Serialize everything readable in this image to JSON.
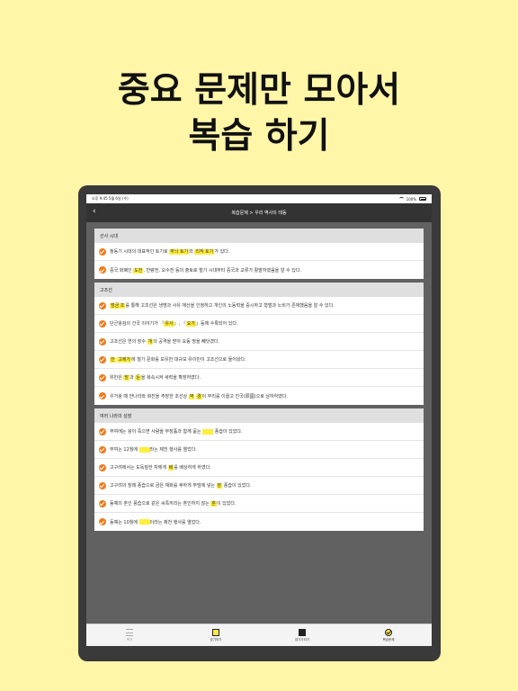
{
  "headline": {
    "line1": "중요 문제만 모아서",
    "line2": "복습 하기"
  },
  "status": {
    "time": "오후 9:45",
    "date": "5월 6일 (수)",
    "battery": "100%"
  },
  "nav": {
    "title": "복습문제 > 우리 역사의 태동"
  },
  "sections": [
    {
      "title": "선사 시대",
      "items": [
        {
          "parts": [
            {
              "t": "청동기 시대의 대표적인 토기로 "
            },
            {
              "t": "무늬 토기",
              "hl": true
            },
            {
              "t": "와 "
            },
            {
              "t": "리작 토기",
              "hl": true
            },
            {
              "t": "가 있다."
            }
          ]
        },
        {
          "parts": [
            {
              "t": "중국 화폐인 "
            },
            {
              "t": "도전",
              "hl": true
            },
            {
              "t": ", 반량전, 오수전 등의 출토로 철기 시대부터 중국과 교류가 활발하였음을 알 수 있다."
            }
          ]
        }
      ]
    },
    {
      "title": "고조선",
      "items": [
        {
          "parts": [
            {
              "t": "범금 조",
              "hl": true
            },
            {
              "t": "를 통해 고조선은 생명과 사유 재산을 인정하고 개인의 노동력을 중시하고 형벌과 노비가 존재했음을 알 수 있다."
            }
          ]
        },
        {
          "parts": [
            {
              "t": "단군왕검의 건국 이야기가 『"
            },
            {
              "t": "유사",
              "hl": true
            },
            {
              "t": "』, 『"
            },
            {
              "t": "요가",
              "hl": true
            },
            {
              "t": "』등에 수록되어 있다."
            }
          ]
        },
        {
          "parts": [
            {
              "t": "고조선은 연의 장수 "
            },
            {
              "t": "개",
              "hl": true
            },
            {
              "t": "의 공격을 받아 요동 땅을 빼앗겼다."
            }
          ]
        },
        {
          "parts": [
            {
              "t": "한",
              "hl": true
            },
            {
              "t": " "
            },
            {
              "t": "고제가",
              "hl": true
            },
            {
              "t": "에 철기 문화를 보유한 대규모 유이민이 고조선으로 들어왔다."
            }
          ]
        },
        {
          "parts": [
            {
              "t": "위만은 "
            },
            {
              "t": "방",
              "hl": true
            },
            {
              "t": "과 "
            },
            {
              "t": "둔",
              "hl": true
            },
            {
              "t": "을 복속시켜 세력을 확장하였다."
            }
          ]
        },
        {
          "parts": [
            {
              "t": "우거왕 때 한나라와 화친을 주장한 조선상 "
            },
            {
              "t": "역",
              "hl": true
            },
            {
              "t": " "
            },
            {
              "t": "경",
              "hl": true
            },
            {
              "t": "이 무리를 이끌고 진국(辰國)으로 남하하였다."
            }
          ]
        }
      ]
    },
    {
      "title": "여러 나라의 성장",
      "items": [
        {
          "parts": [
            {
              "t": "부여에는 왕이 죽으면 사람을 부장품과 함께 묻는 "
            },
            {
              "t": "",
              "hl": true
            },
            {
              "t": " 풍습이 있었다."
            }
          ]
        },
        {
          "parts": [
            {
              "t": "부여는 12월에 "
            },
            {
              "t": "",
              "hl": true
            },
            {
              "t": "라는 제천 행사를 열었다."
            }
          ]
        },
        {
          "parts": [
            {
              "t": "고구려에서는 도독질한 자에게 "
            },
            {
              "t": "배",
              "hl": true
            },
            {
              "t": "를 배상하게 하였다."
            }
          ]
        },
        {
          "parts": [
            {
              "t": "고구려의 장례 풍습으로 금은 재화를 후하게 무덤에 넣는 "
            },
            {
              "t": "장",
              "hl": true
            },
            {
              "t": " 풍습이 있었다."
            }
          ]
        },
        {
          "parts": [
            {
              "t": "동예의 혼인 풍습으로 같은 씨족끼리는 혼인하지 않는 "
            },
            {
              "t": "혼",
              "hl": true
            },
            {
              "t": "이 있었다."
            }
          ]
        },
        {
          "parts": [
            {
              "t": "동예는 10월에 "
            },
            {
              "t": "",
              "hl": true
            },
            {
              "t": "이라는 제천 행사를 열었다."
            }
          ]
        }
      ]
    }
  ],
  "tabs": [
    {
      "label": "목차",
      "icon": "list-icon"
    },
    {
      "label": "암기하기",
      "icon": "flashcard-icon"
    },
    {
      "label": "암기가리기",
      "icon": "cover-icon"
    },
    {
      "label": "복습문제",
      "icon": "check-circle-icon"
    }
  ],
  "colors": {
    "background": "#fff6a8",
    "highlight": "#ffee3c",
    "check": "#f07a1a",
    "navbar": "#333333"
  }
}
